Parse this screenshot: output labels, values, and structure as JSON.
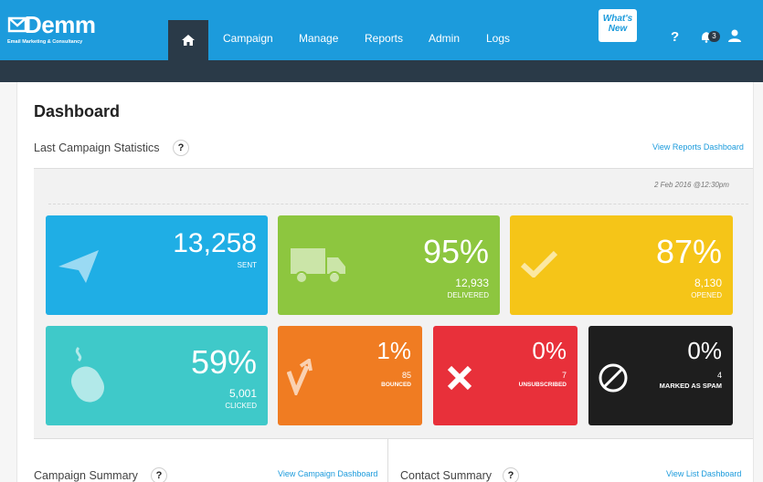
{
  "app": {
    "logo_text": "Demm",
    "logo_sub": "Email Marketing & Consultancy"
  },
  "nav": {
    "items": [
      "Campaign",
      "Manage",
      "Reports",
      "Admin",
      "Logs"
    ]
  },
  "header_right": {
    "whats_new_line1": "What's",
    "whats_new_line2": "New",
    "help_label": "?",
    "notification_count": "3"
  },
  "page": {
    "title": "Dashboard",
    "last_campaign_title": "Last Campaign Statistics",
    "help_symbol": "?",
    "view_reports_link": "View Reports Dashboard",
    "date_stamp": "2 Feb 2016 @12:30pm"
  },
  "stats": {
    "sent": {
      "value": "13,258",
      "label": "SENT",
      "color": "#1faee5"
    },
    "delivered": {
      "value": "95%",
      "count": "12,933",
      "label": "DELIVERED",
      "color": "#8dc63f"
    },
    "opened": {
      "value": "87%",
      "count": "8,130",
      "label": "OPENED",
      "color": "#f5c518"
    },
    "clicked": {
      "value": "59%",
      "count": "5,001",
      "label": "CLICKED",
      "color": "#3fc9c9"
    },
    "bounced": {
      "value": "1%",
      "count": "85",
      "label": "BOUNCED",
      "color": "#f07c22"
    },
    "unsubscribed": {
      "value": "0%",
      "count": "7",
      "label": "UNSUBSCRIBED",
      "color": "#e8303a"
    },
    "spam": {
      "value": "0%",
      "count": "4",
      "label": "MARKED AS SPAM",
      "color": "#1e1e1e"
    }
  },
  "bottom": {
    "campaign_summary_title": "Campaign Summary",
    "view_campaign_link": "View Campaign Dashboard",
    "contact_summary_title": "Contact Summary",
    "view_list_link": "View List Dashboard"
  }
}
